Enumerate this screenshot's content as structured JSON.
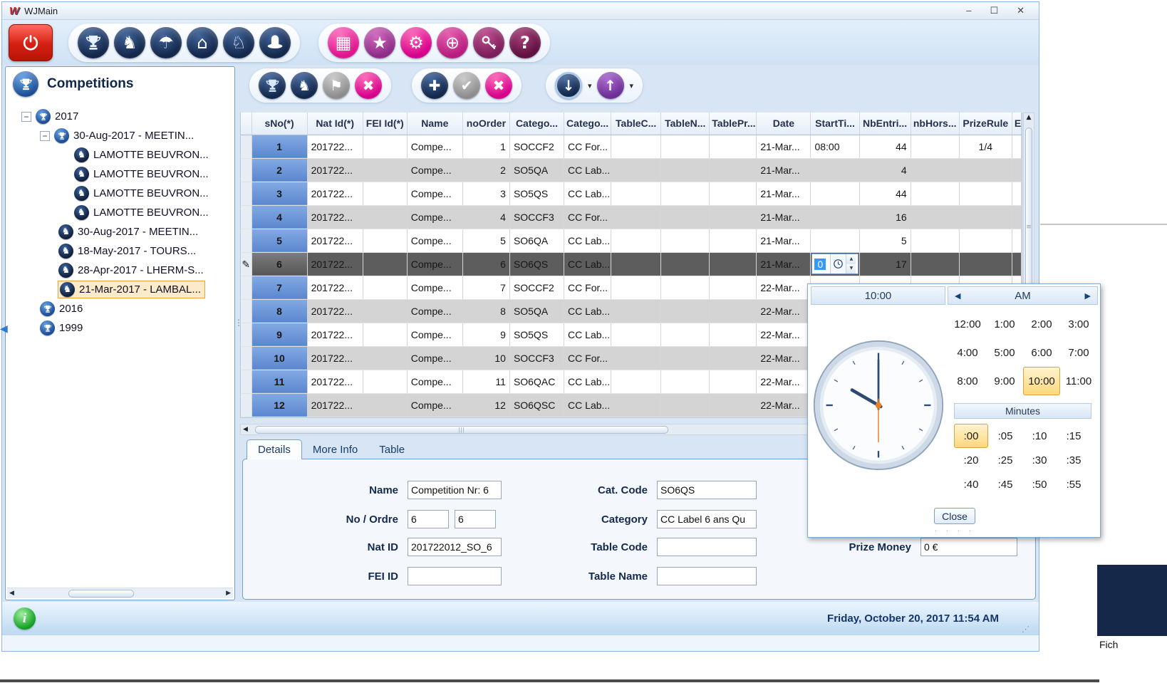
{
  "window": {
    "logo": "W",
    "title": "WJMain",
    "minimize": "–",
    "maximize": "☐",
    "close": "✕"
  },
  "icons": {
    "horse": "♞",
    "knight": "♘",
    "umbrella": "☂",
    "home": "⌂",
    "cells": "▦",
    "star": "★",
    "gear": "⚙",
    "globe": "⊕",
    "help": "?",
    "flags": "⚑",
    "close": "✖",
    "add": "✚",
    "confirm": "✔",
    "download": "↓",
    "upload": "↑",
    "caret": "▾",
    "pencil": "✎",
    "up": "▲",
    "down": "▼",
    "left": "◀",
    "right": "▶",
    "expander_open": "−",
    "info": "i",
    "grip": "⋰",
    "hgrip": "|||",
    "vgrip": "≡",
    "splitter": "⋮",
    "dots": "·  ·  ·  ·"
  },
  "sidebar": {
    "title": "Competitions",
    "tree": [
      {
        "label": "2017"
      },
      {
        "label": "30-Aug-2017 - MEETIN..."
      },
      {
        "label": "LAMOTTE BEUVRON..."
      },
      {
        "label": "LAMOTTE BEUVRON..."
      },
      {
        "label": "LAMOTTE BEUVRON..."
      },
      {
        "label": "LAMOTTE BEUVRON..."
      },
      {
        "label": "30-Aug-2017 - MEETIN..."
      },
      {
        "label": "18-May-2017 - TOURS..."
      },
      {
        "label": "28-Apr-2017 - LHERM-S..."
      },
      {
        "label": "21-Mar-2017 - LAMBAL..."
      },
      {
        "label": "2016"
      },
      {
        "label": "1999"
      }
    ]
  },
  "grid": {
    "columns": [
      "sNo(*)",
      "Nat Id(*)",
      "FEI Id(*)",
      "Name",
      "noOrder",
      "Catego...",
      "Catego...",
      "TableC...",
      "TableN...",
      "TablePr...",
      "Date",
      "StartTi...",
      "NbEntri...",
      "nbHors...",
      "PrizeRule",
      "E"
    ],
    "editor": {
      "value": "0"
    },
    "rows": [
      {
        "sno": "1",
        "nat": "201722...",
        "name": "Compe...",
        "no": "1",
        "cat": "SOCCF2",
        "cat2": "CC For...",
        "date": "21-Mar...",
        "start": "08:00",
        "nbe": "44",
        "prize": "1/4"
      },
      {
        "sno": "2",
        "nat": "201722...",
        "name": "Compe...",
        "no": "2",
        "cat": "SO5QA",
        "cat2": "CC Lab...",
        "date": "21-Mar...",
        "nbe": "4"
      },
      {
        "sno": "3",
        "nat": "201722...",
        "name": "Compe...",
        "no": "3",
        "cat": "SO5QS",
        "cat2": "CC Lab...",
        "date": "21-Mar...",
        "nbe": "44"
      },
      {
        "sno": "4",
        "nat": "201722...",
        "name": "Compe...",
        "no": "4",
        "cat": "SOCCF3",
        "cat2": "CC For...",
        "date": "21-Mar...",
        "nbe": "16"
      },
      {
        "sno": "5",
        "nat": "201722...",
        "name": "Compe...",
        "no": "5",
        "cat": "SO6QA",
        "cat2": "CC Lab...",
        "date": "21-Mar...",
        "nbe": "5"
      },
      {
        "sno": "6",
        "nat": "201722...",
        "name": "Compe...",
        "no": "6",
        "cat": "SO6QS",
        "cat2": "CC Lab...",
        "date": "21-Mar...",
        "nbe": "17"
      },
      {
        "sno": "7",
        "nat": "201722...",
        "name": "Compe...",
        "no": "7",
        "cat": "SOCCF2",
        "cat2": "CC For...",
        "date": "22-Mar..."
      },
      {
        "sno": "8",
        "nat": "201722...",
        "name": "Compe...",
        "no": "8",
        "cat": "SO5QA",
        "cat2": "CC Lab...",
        "date": "22-Mar..."
      },
      {
        "sno": "9",
        "nat": "201722...",
        "name": "Compe...",
        "no": "9",
        "cat": "SO5QS",
        "cat2": "CC Lab...",
        "date": "22-Mar..."
      },
      {
        "sno": "10",
        "nat": "201722...",
        "name": "Compe...",
        "no": "10",
        "cat": "SOCCF3",
        "cat2": "CC For...",
        "date": "22-Mar..."
      },
      {
        "sno": "11",
        "nat": "201722...",
        "name": "Compe...",
        "no": "11",
        "cat": "SO6QAC",
        "cat2": "CC Lab...",
        "date": "22-Mar..."
      },
      {
        "sno": "12",
        "nat": "201722...",
        "name": "Compe...",
        "no": "12",
        "cat": "SO6QSC",
        "cat2": "CC Lab...",
        "date": "22-Mar..."
      }
    ]
  },
  "details": {
    "tabs": [
      "Details",
      "More Info",
      "Table"
    ],
    "name_label": "Name",
    "name_value": "Competition Nr: 6",
    "no_label": "No / Ordre",
    "no_value1": "6",
    "no_value2": "6",
    "natid_label": "Nat ID",
    "natid_value": "201722012_SO_6",
    "feiid_label": "FEI ID",
    "feiid_value": "",
    "catcode_label": "Cat. Code",
    "catcode_value": "SO6QS",
    "category_label": "Category",
    "category_value": "CC Label 6 ans Qu",
    "tablecode_label": "Table Code",
    "tablecode_value": "",
    "tablename_label": "Table Name",
    "tablename_value": "",
    "prize_label": "Prize Money",
    "prize_value": "0 €"
  },
  "timepicker": {
    "hour_display": "10:00",
    "meridiem": "AM",
    "hours": [
      "12:00",
      "1:00",
      "2:00",
      "3:00",
      "4:00",
      "5:00",
      "6:00",
      "7:00",
      "8:00",
      "9:00",
      "10:00",
      "11:00"
    ],
    "minutes_label": "Minutes",
    "minutes": [
      ":00",
      ":05",
      ":10",
      ":15",
      ":20",
      ":25",
      ":30",
      ":35",
      ":40",
      ":45",
      ":50",
      ":55"
    ],
    "close": "Close"
  },
  "statusbar": {
    "date": "Friday, October 20, 2017 11:54 AM"
  },
  "background": {
    "partial_text": "Fich"
  }
}
